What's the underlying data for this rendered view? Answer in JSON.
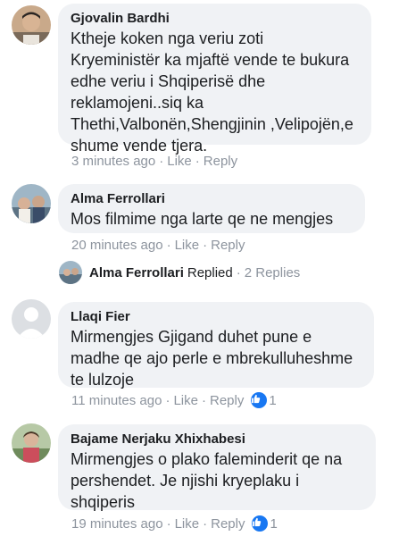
{
  "comments": [
    {
      "author": "Gjovalin Bardhi",
      "lines": [
        "Ktheje koken nga veriu zoti",
        "Kryeministër ka mjaftë vende te bukura",
        "edhe veriu i Shqiperisë dhe",
        "reklamojeni..siq ka",
        "Thethi,Valbonën,Shengjinin ,Velipojën,e",
        "shume vende tjera."
      ],
      "time": "3 minutes ago",
      "like_label": "Like",
      "reply_label": "Reply"
    },
    {
      "author": "Alma Ferrollari",
      "lines": [
        "Mos filmime nga larte qe ne mengjes"
      ],
      "time": "20 minutes ago",
      "like_label": "Like",
      "reply_label": "Reply",
      "replied": {
        "name": "Alma Ferrollari",
        "verb": "Replied",
        "count": "2 Replies"
      }
    },
    {
      "author": "Llaqi Fier",
      "lines": [
        "Mirmengjes Gjigand duhet pune e",
        "madhe qe ajo perle e mbrekulluheshme",
        "te lulzoje"
      ],
      "time": "11 minutes ago",
      "like_label": "Like",
      "reply_label": "Reply",
      "likes": "1"
    },
    {
      "author": "Bajame Nerjaku Xhixhabesi",
      "lines": [
        "Mirmengjes o plako faleminderit qe na",
        "pershendet. Je njishi kryeplaku i",
        "shqiperis"
      ],
      "time": "19 minutes ago",
      "like_label": "Like",
      "reply_label": "Reply",
      "likes": "1"
    }
  ],
  "separator": "·",
  "colors": {
    "bubble": "#f0f2f5",
    "meta": "#8d949e",
    "like_badge": "#1877f2"
  }
}
